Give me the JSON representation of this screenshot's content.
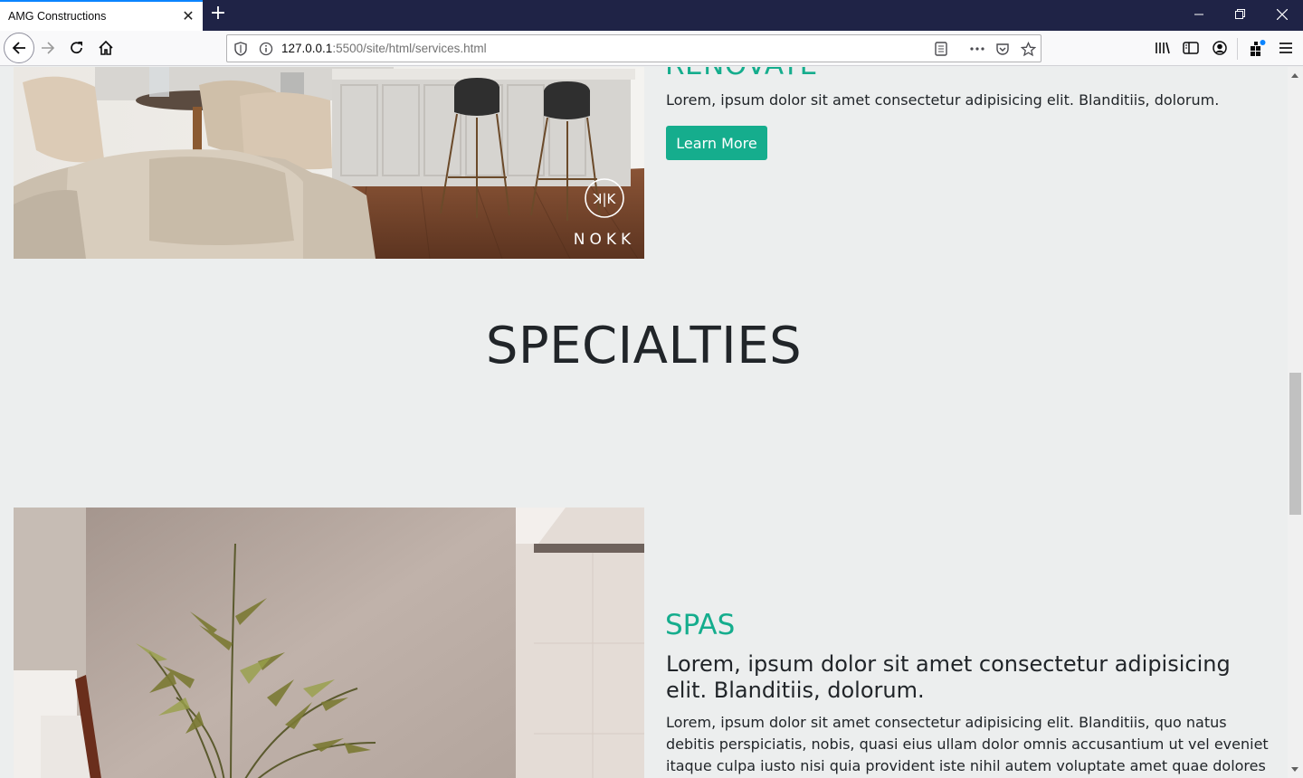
{
  "browser": {
    "tab_title": "AMG Constructions",
    "url_host": "127.0.0.1",
    "url_path": ":5500/site/html/services.html"
  },
  "renovate": {
    "title": "RENOVATE",
    "text": "Lorem, ipsum dolor sit amet consectetur adipisicing elit. Blanditiis, dolorum.",
    "button_label": "Learn More",
    "image_watermark": "NOKK"
  },
  "specialties": {
    "heading": "SPECIALTIES"
  },
  "spas": {
    "title": "SPAS",
    "lead": "Lorem, ipsum dolor sit amet consectetur adipisicing elit. Blanditiis, dolorum.",
    "text": "Lorem, ipsum dolor sit amet consectetur adipisicing elit. Blanditiis, quo natus debitis perspiciatis, nobis, quasi eius ullam dolor omnis accusantium ut vel eveniet itaque culpa iusto nisi quia provident iste nihil autem voluptate amet quae dolores consectetur."
  },
  "colors": {
    "accent": "#15ad8d",
    "page_bg": "#eceeee",
    "tabbar_bg": "#1f2346"
  }
}
